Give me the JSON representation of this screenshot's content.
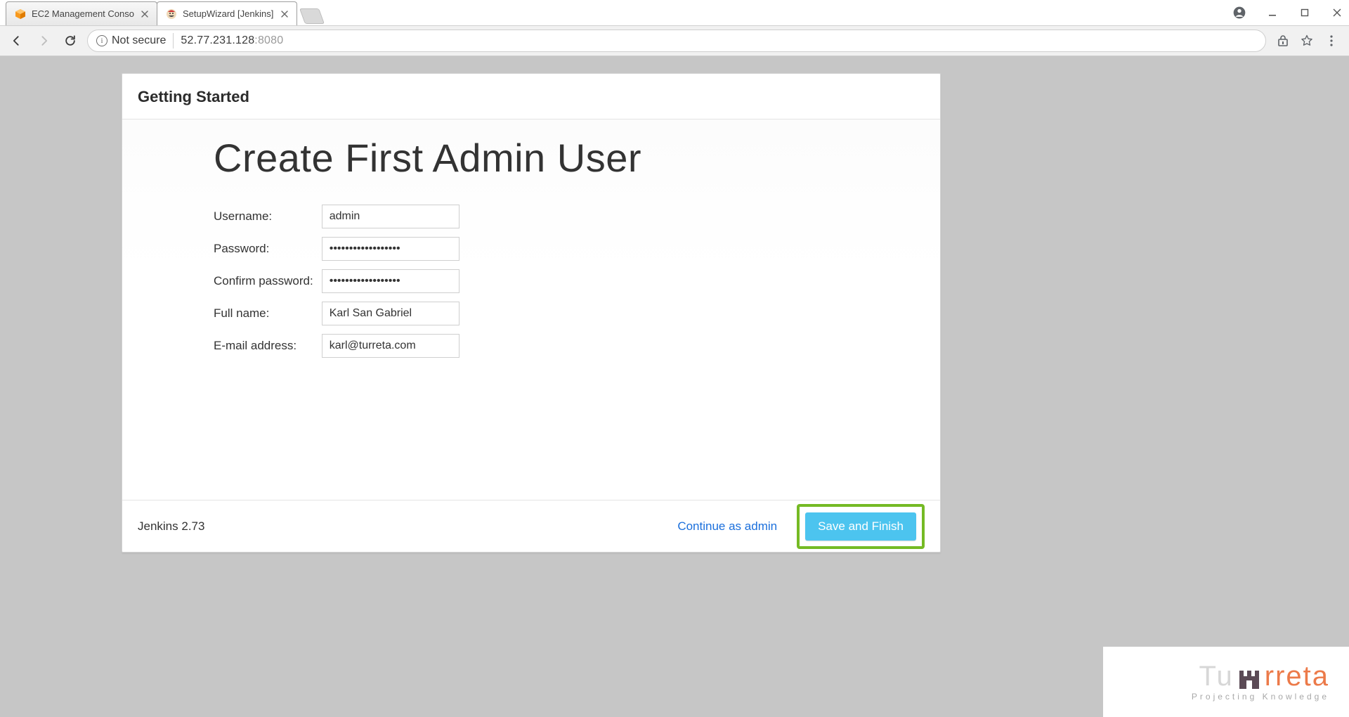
{
  "browser": {
    "tabs": [
      {
        "title": "EC2 Management Conso"
      },
      {
        "title": "SetupWizard [Jenkins]"
      }
    ],
    "not_secure_label": "Not secure",
    "url_host": "52.77.231.128",
    "url_port": ":8080"
  },
  "page": {
    "header": "Getting Started",
    "title": "Create First Admin User",
    "form": {
      "username_label": "Username:",
      "username_value": "admin",
      "password_label": "Password:",
      "password_value": "••••••••••••••••••",
      "confirm_label": "Confirm password:",
      "confirm_value": "••••••••••••••••••",
      "fullname_label": "Full name:",
      "fullname_value": "Karl San Gabriel",
      "email_label": "E-mail address:",
      "email_value": "karl@turreta.com"
    },
    "footer": {
      "version": "Jenkins 2.73",
      "continue_label": "Continue as admin",
      "save_label": "Save and Finish"
    }
  },
  "watermark": {
    "left_letters": "Tu",
    "right_letters": "rreta",
    "tagline": "Projecting Knowledge"
  }
}
